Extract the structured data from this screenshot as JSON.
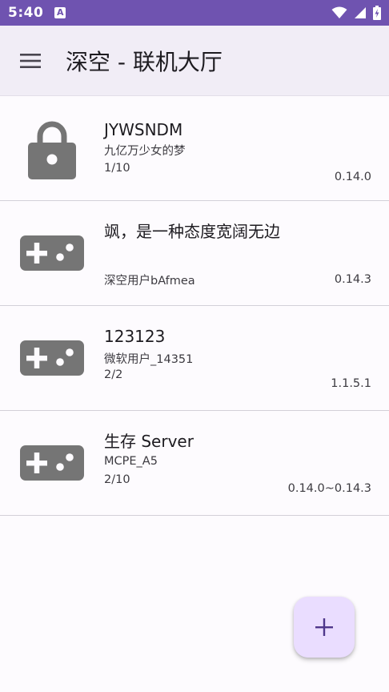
{
  "status_bar": {
    "time": "5:40",
    "notification_icon": "a-icon",
    "icons": [
      "wifi-icon",
      "signal-icon",
      "battery-charging-icon"
    ]
  },
  "app_bar": {
    "menu_icon": "menu-icon",
    "title": "深空 - 联机大厅"
  },
  "rooms": [
    {
      "icon": "lock-icon",
      "name": "JYWSNDM",
      "owner": "九亿万少女的梦",
      "players": "1/10",
      "version": "0.14.0"
    },
    {
      "icon": "gamepad-icon",
      "name": "飒，是一种态度宽阔无边",
      "owner": "深空用户bAfmea",
      "players": "",
      "version": "0.14.3"
    },
    {
      "icon": "gamepad-icon",
      "name": "123123",
      "owner": "微软用户_14351",
      "players": "2/2",
      "version": "1.1.5.1"
    },
    {
      "icon": "gamepad-icon",
      "name": "生存 Server",
      "owner": "MCPE_A5",
      "players": "2/10",
      "version": "0.14.0~0.14.3"
    }
  ],
  "fab": {
    "icon": "plus-icon",
    "label": "+"
  },
  "colors": {
    "status_bar": "#6f53b0",
    "app_bar": "#f1edf6",
    "icon_gray": "#757575",
    "fab_background": "#eaddff",
    "fab_icon": "#4f378b"
  }
}
